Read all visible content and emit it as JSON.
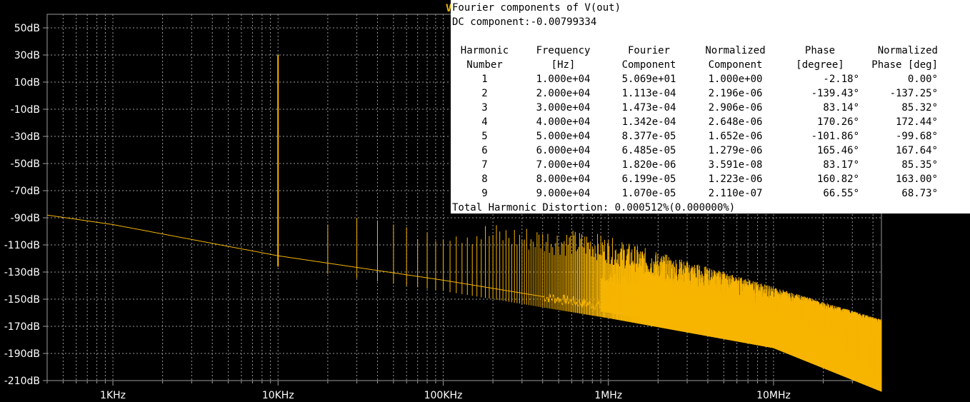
{
  "plot": {
    "trace_marker": "V",
    "y_ticks": [
      "50dB",
      "30dB",
      "10dB",
      "-10dB",
      "-30dB",
      "-50dB",
      "-70dB",
      "-90dB",
      "-110dB",
      "-130dB",
      "-150dB",
      "-170dB",
      "-190dB",
      "-210dB"
    ],
    "x_ticks": [
      "1KHz",
      "10KHz",
      "100KHz",
      "1MHz",
      "10MHz"
    ],
    "trace_color": "#f7b500",
    "grid_color": "#9a9a9a",
    "background": "#000000"
  },
  "chart_data": {
    "type": "line",
    "x_scale": "log",
    "xlim": [
      400,
      45000000
    ],
    "ylim": [
      -210,
      60
    ],
    "series": [
      {
        "noise_floor_points": [
          [
            400,
            -88
          ],
          [
            1000,
            -95
          ],
          [
            10000,
            -118
          ],
          [
            100000,
            -136
          ],
          [
            1000000,
            -156
          ],
          [
            10000000,
            -178
          ],
          [
            45000000,
            -210
          ]
        ],
        "peaks": [
          [
            10000,
            30
          ],
          [
            20000,
            -95
          ],
          [
            30000,
            -90
          ],
          [
            40000,
            -92
          ],
          [
            50000,
            -95
          ],
          [
            60000,
            -97
          ]
        ]
      }
    ]
  },
  "fourier": {
    "title": "Fourier components of V(out)",
    "dc": "DC component:-0.00799334",
    "headers": [
      [
        "Harmonic",
        "Number"
      ],
      [
        "Frequency",
        "[Hz]"
      ],
      [
        "Fourier",
        "Component"
      ],
      [
        "Normalized",
        "Component"
      ],
      [
        "Phase",
        "[degree]"
      ],
      [
        "Normalized",
        "Phase [deg]"
      ]
    ],
    "rows": [
      [
        "1",
        "1.000e+04",
        "5.069e+01",
        "1.000e+00",
        "-2.18°",
        "0.00°"
      ],
      [
        "2",
        "2.000e+04",
        "1.113e-04",
        "2.196e-06",
        "-139.43°",
        "-137.25°"
      ],
      [
        "3",
        "3.000e+04",
        "1.473e-04",
        "2.906e-06",
        "83.14°",
        "85.32°"
      ],
      [
        "4",
        "4.000e+04",
        "1.342e-04",
        "2.648e-06",
        "170.26°",
        "172.44°"
      ],
      [
        "5",
        "5.000e+04",
        "8.377e-05",
        "1.652e-06",
        "-101.86°",
        "-99.68°"
      ],
      [
        "6",
        "6.000e+04",
        "6.485e-05",
        "1.279e-06",
        "165.46°",
        "167.64°"
      ],
      [
        "7",
        "7.000e+04",
        "1.820e-06",
        "3.591e-08",
        "83.17°",
        "85.35°"
      ],
      [
        "8",
        "8.000e+04",
        "6.199e-05",
        "1.223e-06",
        "160.82°",
        "163.00°"
      ],
      [
        "9",
        "9.000e+04",
        "1.070e-05",
        "2.110e-07",
        "66.55°",
        "68.73°"
      ]
    ],
    "thd": "Total Harmonic Distortion: 0.000512%(0.000000%)"
  }
}
